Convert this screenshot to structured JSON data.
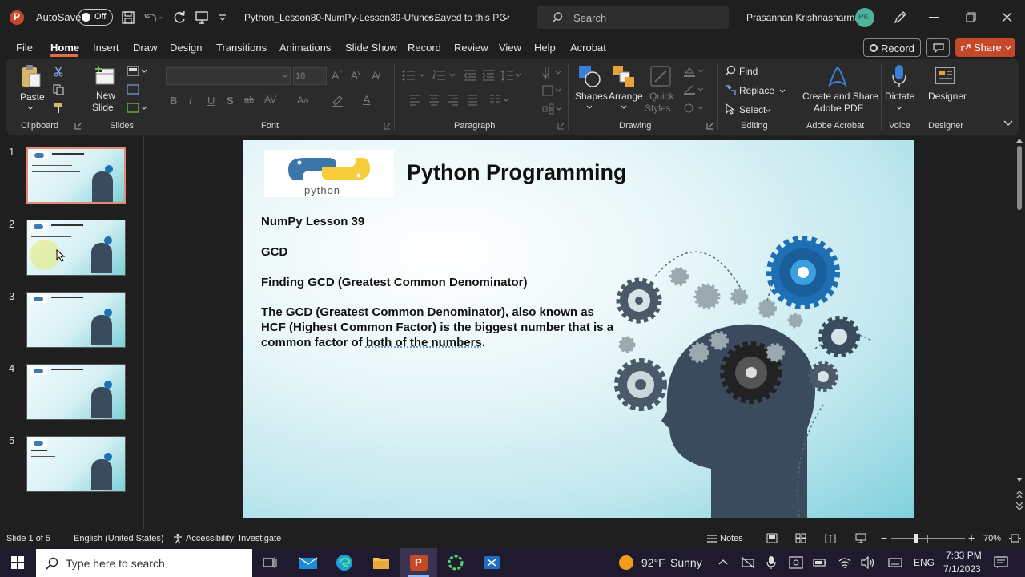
{
  "titlebar": {
    "autosave_label": "AutoSave",
    "autosave_state": "Off",
    "document_title": "Python_Lesson80-NumPy-Lesson39-Ufuncs...",
    "save_status": "• Saved to this PC",
    "search_placeholder": "Search",
    "user_name": "Prasannan Krishnasharma",
    "user_initials": "PK"
  },
  "menu": {
    "items": [
      "File",
      "Home",
      "Insert",
      "Draw",
      "Design",
      "Transitions",
      "Animations",
      "Slide Show",
      "Record",
      "Review",
      "View",
      "Help",
      "Acrobat"
    ],
    "active": "Home",
    "record_button": "Record",
    "share_button": "Share"
  },
  "ribbon": {
    "clipboard": {
      "label": "Clipboard",
      "paste": "Paste"
    },
    "slides": {
      "label": "Slides",
      "new_slide_1": "New",
      "new_slide_2": "Slide"
    },
    "font": {
      "label": "Font",
      "size": "18"
    },
    "paragraph": {
      "label": "Paragraph"
    },
    "drawing": {
      "label": "Drawing",
      "shapes": "Shapes",
      "arrange": "Arrange",
      "quick_styles_1": "Quick",
      "quick_styles_2": "Styles"
    },
    "editing": {
      "label": "Editing",
      "find": "Find",
      "replace": "Replace",
      "select": "Select"
    },
    "acrobat": {
      "label": "Adobe Acrobat",
      "line1": "Create and Share",
      "line2": "Adobe PDF"
    },
    "voice": {
      "label": "Voice",
      "dictate": "Dictate"
    },
    "designer": {
      "label": "Designer",
      "button": "Designer"
    }
  },
  "thumbnails": {
    "numbers": [
      "1",
      "2",
      "3",
      "4",
      "5"
    ],
    "selected": 1
  },
  "slide": {
    "title": "Python Programming",
    "logo_text": "python",
    "line1": "NumPy Lesson 39",
    "line2": "GCD",
    "line3": "Finding GCD (Greatest Common Denominator)",
    "para1": "The GCD (Greatest Common Denominator), also known as",
    "para2": "HCF (Highest Common Factor) is the biggest number that is a",
    "para3_a": "common factor of ",
    "para3_b": "both of the numbers",
    "para3_c": "."
  },
  "status": {
    "slide_info": "Slide 1 of 5",
    "language": "English (United States)",
    "accessibility": "Accessibility: Investigate",
    "notes": "Notes",
    "zoom": "70%"
  },
  "taskbar": {
    "search_placeholder": "Type here to search",
    "weather_temp": "92°F",
    "weather_desc": "Sunny",
    "language": "ENG",
    "time": "7:33 PM",
    "date": "7/1/2023"
  },
  "colors": {
    "accent": "#e56b49",
    "share": "#c4482a",
    "background": "#1f1f1f",
    "ribbon": "#2b2b2b",
    "slide_bg": "#bfe7ee"
  }
}
